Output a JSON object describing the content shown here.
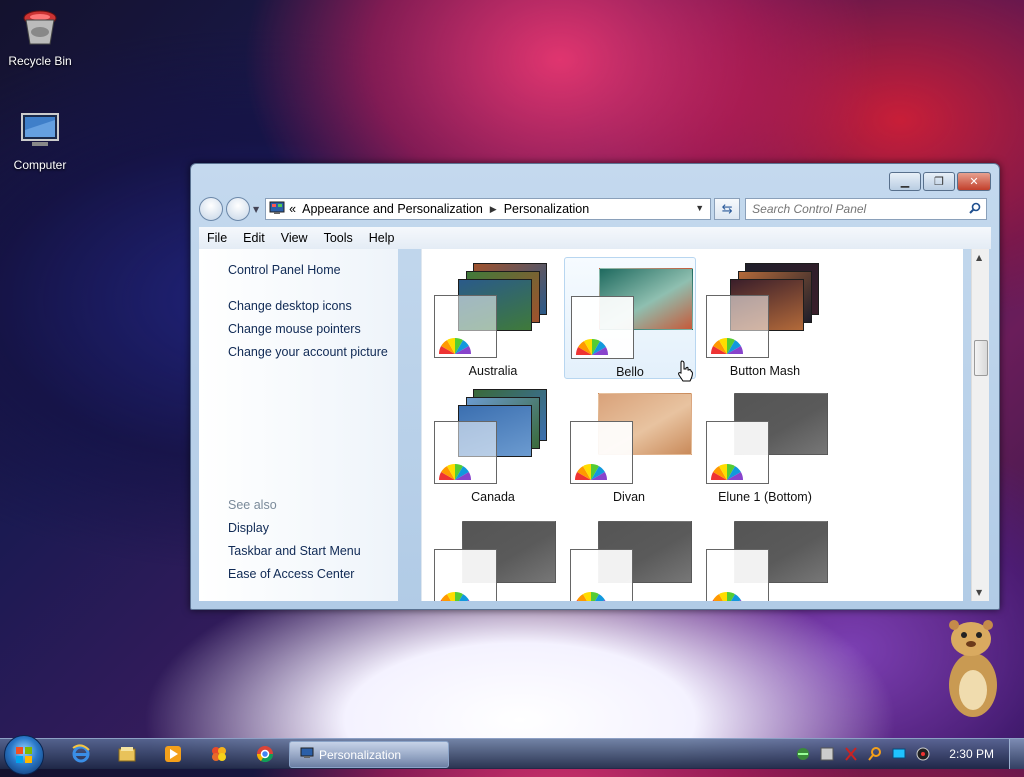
{
  "desktop": {
    "icons": [
      {
        "label": "Recycle Bin"
      },
      {
        "label": "Computer"
      }
    ]
  },
  "window": {
    "address": {
      "crumbs": [
        "Appearance and Personalization",
        "Personalization"
      ],
      "prefix": "«"
    },
    "search": {
      "placeholder": "Search Control Panel"
    },
    "menu": [
      "File",
      "Edit",
      "View",
      "Tools",
      "Help"
    ],
    "left_pane": {
      "links": [
        "Control Panel Home",
        "Change desktop icons",
        "Change mouse pointers",
        "Change your account picture"
      ],
      "see_also_label": "See also",
      "see_also": [
        "Display",
        "Taskbar and Start Menu",
        "Ease of Access Center"
      ]
    },
    "themes": [
      {
        "name": "Australia",
        "colors": [
          "#2a5a8a",
          "#3f7a3a",
          "#a0522d"
        ]
      },
      {
        "name": "Bello",
        "colors": [
          "#1f6a5f",
          "#8fbfb0",
          "#c65a3a"
        ]
      },
      {
        "name": "Button Mash",
        "colors": [
          "#3a1e2a",
          "#b36a3a",
          "#1e1e2a"
        ]
      },
      {
        "name": "Canada",
        "colors": [
          "#3b6fb0",
          "#6c9bd0",
          "#3a6a3a"
        ]
      },
      {
        "name": "Divan",
        "colors": [
          "#d9a27a",
          "#e8c3a0",
          "#c98a5a"
        ]
      },
      {
        "name": "Elune 1 (Bottom)",
        "colors": [
          "#555555",
          "#5a5a5a",
          "#777777"
        ]
      },
      {
        "name": "",
        "colors": [
          "#555555",
          "#5a5a5a",
          "#777777"
        ]
      },
      {
        "name": "",
        "colors": [
          "#555555",
          "#5a5a5a",
          "#777777"
        ]
      },
      {
        "name": "",
        "colors": [
          "#555555",
          "#5a5a5a",
          "#777777"
        ]
      }
    ]
  },
  "taskbar": {
    "active_task": "Personalization",
    "clock": "2:30 PM"
  }
}
